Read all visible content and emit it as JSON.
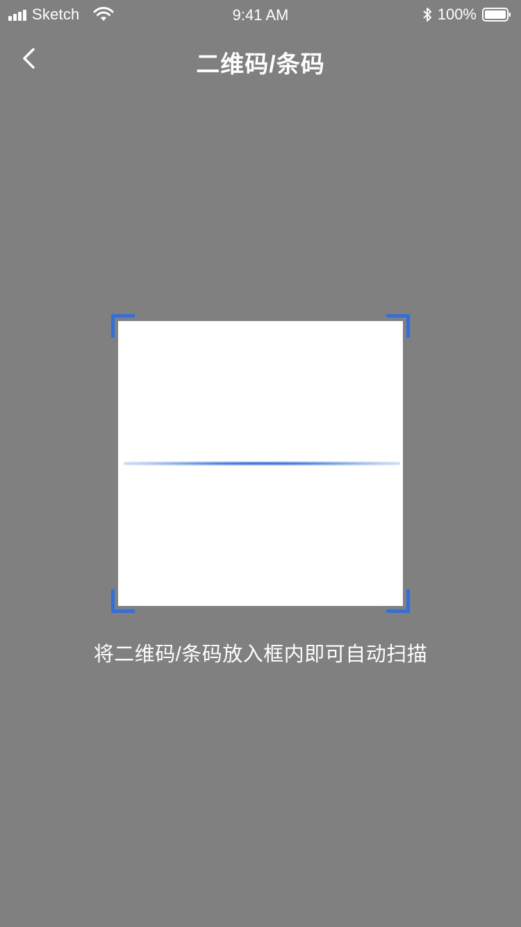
{
  "status_bar": {
    "carrier": "Sketch",
    "time": "9:41 AM",
    "battery_percent": "100%",
    "battery_level": 1.0,
    "icons": [
      "signal-icon",
      "wifi-icon",
      "bluetooth-icon",
      "battery-icon"
    ]
  },
  "nav": {
    "back_icon": "chevron-left-icon",
    "title": "二维码/条码"
  },
  "scanner": {
    "hint": "将二维码/条码放入框内即可自动扫描",
    "accent_color": "#2f6fe0",
    "background_color": "#808080"
  }
}
